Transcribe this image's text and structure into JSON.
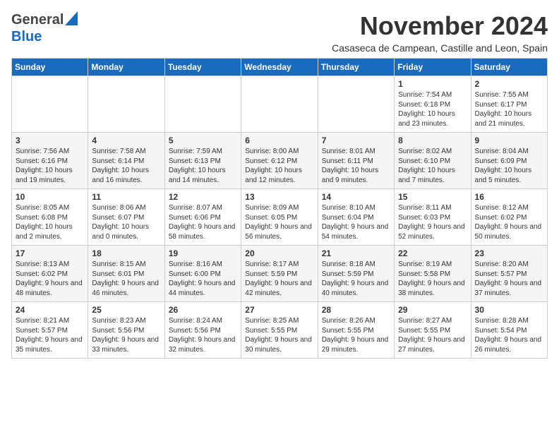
{
  "header": {
    "logo_general": "General",
    "logo_blue": "Blue",
    "month_title": "November 2024",
    "subtitle": "Casaseca de Campean, Castille and Leon, Spain"
  },
  "days_of_week": [
    "Sunday",
    "Monday",
    "Tuesday",
    "Wednesday",
    "Thursday",
    "Friday",
    "Saturday"
  ],
  "weeks": [
    [
      {
        "day": "",
        "content": ""
      },
      {
        "day": "",
        "content": ""
      },
      {
        "day": "",
        "content": ""
      },
      {
        "day": "",
        "content": ""
      },
      {
        "day": "",
        "content": ""
      },
      {
        "day": "1",
        "content": "Sunrise: 7:54 AM\nSunset: 6:18 PM\nDaylight: 10 hours and 23 minutes."
      },
      {
        "day": "2",
        "content": "Sunrise: 7:55 AM\nSunset: 6:17 PM\nDaylight: 10 hours and 21 minutes."
      }
    ],
    [
      {
        "day": "3",
        "content": "Sunrise: 7:56 AM\nSunset: 6:16 PM\nDaylight: 10 hours and 19 minutes."
      },
      {
        "day": "4",
        "content": "Sunrise: 7:58 AM\nSunset: 6:14 PM\nDaylight: 10 hours and 16 minutes."
      },
      {
        "day": "5",
        "content": "Sunrise: 7:59 AM\nSunset: 6:13 PM\nDaylight: 10 hours and 14 minutes."
      },
      {
        "day": "6",
        "content": "Sunrise: 8:00 AM\nSunset: 6:12 PM\nDaylight: 10 hours and 12 minutes."
      },
      {
        "day": "7",
        "content": "Sunrise: 8:01 AM\nSunset: 6:11 PM\nDaylight: 10 hours and 9 minutes."
      },
      {
        "day": "8",
        "content": "Sunrise: 8:02 AM\nSunset: 6:10 PM\nDaylight: 10 hours and 7 minutes."
      },
      {
        "day": "9",
        "content": "Sunrise: 8:04 AM\nSunset: 6:09 PM\nDaylight: 10 hours and 5 minutes."
      }
    ],
    [
      {
        "day": "10",
        "content": "Sunrise: 8:05 AM\nSunset: 6:08 PM\nDaylight: 10 hours and 2 minutes."
      },
      {
        "day": "11",
        "content": "Sunrise: 8:06 AM\nSunset: 6:07 PM\nDaylight: 10 hours and 0 minutes."
      },
      {
        "day": "12",
        "content": "Sunrise: 8:07 AM\nSunset: 6:06 PM\nDaylight: 9 hours and 58 minutes."
      },
      {
        "day": "13",
        "content": "Sunrise: 8:09 AM\nSunset: 6:05 PM\nDaylight: 9 hours and 56 minutes."
      },
      {
        "day": "14",
        "content": "Sunrise: 8:10 AM\nSunset: 6:04 PM\nDaylight: 9 hours and 54 minutes."
      },
      {
        "day": "15",
        "content": "Sunrise: 8:11 AM\nSunset: 6:03 PM\nDaylight: 9 hours and 52 minutes."
      },
      {
        "day": "16",
        "content": "Sunrise: 8:12 AM\nSunset: 6:02 PM\nDaylight: 9 hours and 50 minutes."
      }
    ],
    [
      {
        "day": "17",
        "content": "Sunrise: 8:13 AM\nSunset: 6:02 PM\nDaylight: 9 hours and 48 minutes."
      },
      {
        "day": "18",
        "content": "Sunrise: 8:15 AM\nSunset: 6:01 PM\nDaylight: 9 hours and 46 minutes."
      },
      {
        "day": "19",
        "content": "Sunrise: 8:16 AM\nSunset: 6:00 PM\nDaylight: 9 hours and 44 minutes."
      },
      {
        "day": "20",
        "content": "Sunrise: 8:17 AM\nSunset: 5:59 PM\nDaylight: 9 hours and 42 minutes."
      },
      {
        "day": "21",
        "content": "Sunrise: 8:18 AM\nSunset: 5:59 PM\nDaylight: 9 hours and 40 minutes."
      },
      {
        "day": "22",
        "content": "Sunrise: 8:19 AM\nSunset: 5:58 PM\nDaylight: 9 hours and 38 minutes."
      },
      {
        "day": "23",
        "content": "Sunrise: 8:20 AM\nSunset: 5:57 PM\nDaylight: 9 hours and 37 minutes."
      }
    ],
    [
      {
        "day": "24",
        "content": "Sunrise: 8:21 AM\nSunset: 5:57 PM\nDaylight: 9 hours and 35 minutes."
      },
      {
        "day": "25",
        "content": "Sunrise: 8:23 AM\nSunset: 5:56 PM\nDaylight: 9 hours and 33 minutes."
      },
      {
        "day": "26",
        "content": "Sunrise: 8:24 AM\nSunset: 5:56 PM\nDaylight: 9 hours and 32 minutes."
      },
      {
        "day": "27",
        "content": "Sunrise: 8:25 AM\nSunset: 5:55 PM\nDaylight: 9 hours and 30 minutes."
      },
      {
        "day": "28",
        "content": "Sunrise: 8:26 AM\nSunset: 5:55 PM\nDaylight: 9 hours and 29 minutes."
      },
      {
        "day": "29",
        "content": "Sunrise: 8:27 AM\nSunset: 5:55 PM\nDaylight: 9 hours and 27 minutes."
      },
      {
        "day": "30",
        "content": "Sunrise: 8:28 AM\nSunset: 5:54 PM\nDaylight: 9 hours and 26 minutes."
      }
    ]
  ]
}
